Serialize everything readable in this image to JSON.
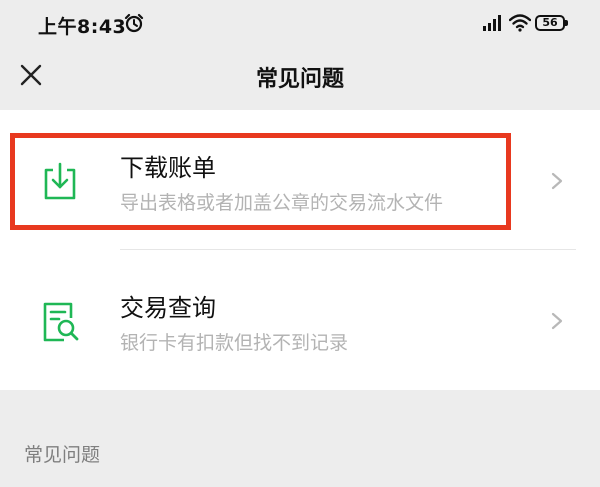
{
  "status_bar": {
    "time": "上午8:43",
    "battery": "56",
    "icons": [
      "alarm-icon",
      "signal-icon",
      "wifi-icon",
      "battery-icon"
    ]
  },
  "nav": {
    "title": "常见问题",
    "close_icon": "close-icon"
  },
  "items": [
    {
      "title": "下载账单",
      "subtitle": "导出表格或者加盖公章的交易流水文件",
      "icon": "download-icon"
    },
    {
      "title": "交易查询",
      "subtitle": "银行卡有扣款但找不到记录",
      "icon": "document-search-icon"
    }
  ],
  "section": {
    "label": "常见问题"
  },
  "colors": {
    "accent_green": "#1fb755",
    "highlight_red": "#e8391f",
    "background": "#ededed",
    "subtitle_gray": "#b3b3b3"
  }
}
